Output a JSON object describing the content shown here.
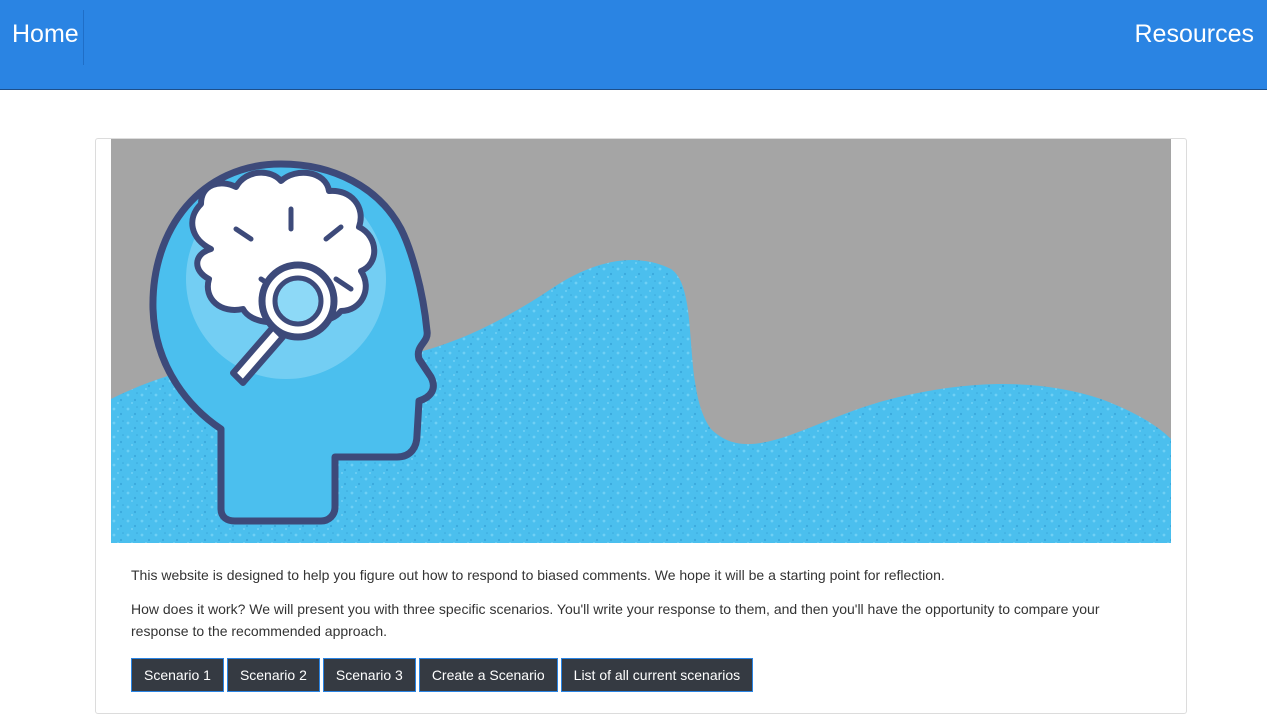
{
  "nav": {
    "home_label": "Home",
    "resources_label": "Resources"
  },
  "hero": {
    "icon": "brain-magnifier-head-icon",
    "colors": {
      "background": "#a5a5a5",
      "wave": "#4bbfee",
      "outline": "#3d4a7a"
    }
  },
  "intro": {
    "paragraph1": "This website is designed to help you figure out how to respond to biased comments. We hope it will be a starting point for reflection.",
    "paragraph2": "How does it work? We will present you with three specific scenarios. You'll write your response to them, and then you'll have the opportunity to compare your response to the recommended approach."
  },
  "buttons": {
    "scenario1": "Scenario 1",
    "scenario2": "Scenario 2",
    "scenario3": "Scenario 3",
    "create": "Create a Scenario",
    "list": "List of all current scenarios"
  },
  "colors": {
    "navbar": "#2a84e3",
    "button_bg": "#353a42",
    "button_border": "#2a84e3"
  }
}
